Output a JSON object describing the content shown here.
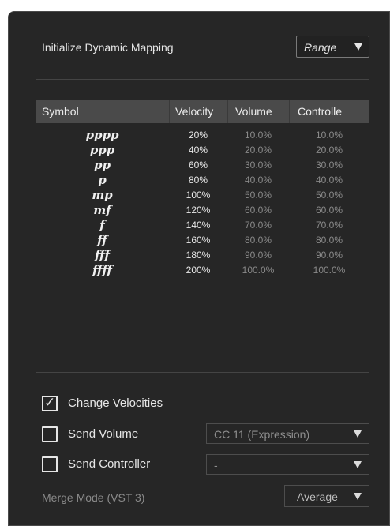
{
  "header": {
    "title": "Initialize Dynamic Mapping",
    "range_select": "Range"
  },
  "table": {
    "columns": [
      "Symbol",
      "Velocity",
      "Volume",
      "Controlle"
    ],
    "rows": [
      {
        "symbol": "pppp",
        "velocity": "20%",
        "volume": "10.0%",
        "controller": "10.0%"
      },
      {
        "symbol": "ppp",
        "velocity": "40%",
        "volume": "20.0%",
        "controller": "20.0%"
      },
      {
        "symbol": "pp",
        "velocity": "60%",
        "volume": "30.0%",
        "controller": "30.0%"
      },
      {
        "symbol": "p",
        "velocity": "80%",
        "volume": "40.0%",
        "controller": "40.0%"
      },
      {
        "symbol": "mp",
        "velocity": "100%",
        "volume": "50.0%",
        "controller": "50.0%"
      },
      {
        "symbol": "mf",
        "velocity": "120%",
        "volume": "60.0%",
        "controller": "60.0%"
      },
      {
        "symbol": "f",
        "velocity": "140%",
        "volume": "70.0%",
        "controller": "70.0%"
      },
      {
        "symbol": "ff",
        "velocity": "160%",
        "volume": "80.0%",
        "controller": "80.0%"
      },
      {
        "symbol": "fff",
        "velocity": "180%",
        "volume": "90.0%",
        "controller": "90.0%"
      },
      {
        "symbol": "ffff",
        "velocity": "200%",
        "volume": "100.0%",
        "controller": "100.0%"
      }
    ]
  },
  "options": {
    "change_velocities": {
      "label": "Change Velocities",
      "checked": true,
      "check_glyph": "✓"
    },
    "send_volume": {
      "label": "Send Volume",
      "checked": false,
      "dropdown": "CC 11 (Expression)"
    },
    "send_controller": {
      "label": "Send Controller",
      "checked": false,
      "dropdown": "-"
    },
    "merge_mode": {
      "label": "Merge Mode (VST 3)",
      "dropdown": "Average"
    }
  },
  "colors": {
    "panel_bg": "#262626",
    "header_bg": "#4a4a4a",
    "text": "#e6e6e6",
    "dim_text": "#8a8a8a"
  },
  "icons": [
    "dropdown-arrow-icon",
    "checkmark-icon"
  ]
}
